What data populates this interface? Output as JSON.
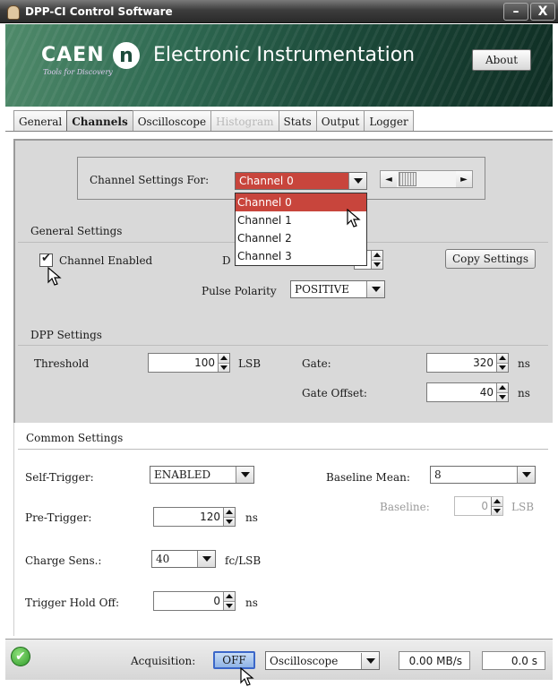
{
  "window": {
    "title": "DPP-CI Control Software",
    "minimize_glyph": "–",
    "close_glyph": "X"
  },
  "banner": {
    "brand": "CAEN",
    "tagline": "Tools for Discovery",
    "logo_letter": "n",
    "subtitle": "Electronic Instrumentation",
    "about_label": "About"
  },
  "tabs": [
    {
      "label": "General",
      "state": "normal"
    },
    {
      "label": "Channels",
      "state": "active"
    },
    {
      "label": "Oscilloscope",
      "state": "normal"
    },
    {
      "label": "Histogram",
      "state": "disabled"
    },
    {
      "label": "Stats",
      "state": "normal"
    },
    {
      "label": "Output",
      "state": "normal"
    },
    {
      "label": "Logger",
      "state": "normal"
    }
  ],
  "channel_select": {
    "label": "Channel Settings For:",
    "value": "Channel 0",
    "options": [
      "Channel 0",
      "Channel 1",
      "Channel 2",
      "Channel 3"
    ],
    "prev_glyph": "◄",
    "next_glyph": "►"
  },
  "general_settings": {
    "title": "General Settings",
    "channel_enabled_label": "Channel Enabled",
    "channel_enabled": true,
    "hidden_label_fragment": "D",
    "copy_settings_label": "Copy Settings",
    "pulse_polarity_label": "Pulse Polarity",
    "pulse_polarity_value": "POSITIVE"
  },
  "dpp_settings": {
    "title": "DPP Settings",
    "threshold_label": "Threshold",
    "threshold_value": "100",
    "threshold_unit": "LSB",
    "gate_label": "Gate:",
    "gate_value": "320",
    "gate_unit": "ns",
    "gate_offset_label": "Gate Offset:",
    "gate_offset_value": "40",
    "gate_offset_unit": "ns"
  },
  "common_settings": {
    "title": "Common Settings",
    "self_trigger_label": "Self-Trigger:",
    "self_trigger_value": "ENABLED",
    "baseline_mean_label": "Baseline Mean:",
    "baseline_mean_value": "8",
    "baseline_label": "Baseline:",
    "baseline_value": "0",
    "baseline_unit": "LSB",
    "pre_trigger_label": "Pre-Trigger:",
    "pre_trigger_value": "120",
    "pre_trigger_unit": "ns",
    "charge_sens_label": "Charge Sens.:",
    "charge_sens_value": "40",
    "charge_sens_unit": "fc/LSB",
    "trigger_hold_off_label": "Trigger Hold Off:",
    "trigger_hold_off_value": "0",
    "trigger_hold_off_unit": "ns"
  },
  "status": {
    "ok_glyph": "✔",
    "acquisition_label": "Acquisition:",
    "acquisition_button": "OFF",
    "mode_value": "Oscilloscope",
    "rate": "0.00 MB/s",
    "time": "0.0 s"
  },
  "colors": {
    "selected_red": "#c8453c",
    "panel_gray": "#d9d9d9",
    "ok_green": "#2f9a2a",
    "off_blue": "#3b67c9"
  }
}
